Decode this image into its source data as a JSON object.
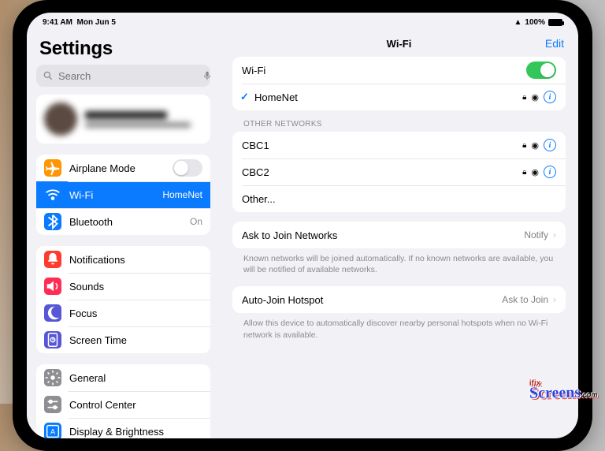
{
  "status": {
    "time": "9:41 AM",
    "date": "Mon Jun 5",
    "battery": "100%"
  },
  "sidebar": {
    "title": "Settings",
    "search_placeholder": "Search",
    "items": {
      "airplane": "Airplane Mode",
      "wifi": "Wi-Fi",
      "wifi_value": "HomeNet",
      "bluetooth": "Bluetooth",
      "bluetooth_value": "On",
      "notifications": "Notifications",
      "sounds": "Sounds",
      "focus": "Focus",
      "screentime": "Screen Time",
      "general": "General",
      "control": "Control Center",
      "display": "Display & Brightness"
    }
  },
  "detail": {
    "title": "Wi-Fi",
    "edit": "Edit",
    "wifi_label": "Wi-Fi",
    "connected": "HomeNet",
    "other_header": "OTHER NETWORKS",
    "networks": {
      "n1": "CBC1",
      "n2": "CBC2",
      "other": "Other..."
    },
    "ask_label": "Ask to Join Networks",
    "ask_value": "Notify",
    "ask_desc": "Known networks will be joined automatically. If no known networks are available, you will be notified of available networks.",
    "auto_label": "Auto-Join Hotspot",
    "auto_value": "Ask to Join",
    "auto_desc": "Allow this device to automatically discover nearby personal hotspots when no Wi-Fi network is available."
  },
  "colors": {
    "orange": "#ff9502",
    "blue": "#0a7aff",
    "red": "#ff3b30",
    "pinkred": "#ff2d55",
    "indigo": "#5856d6",
    "gray": "#8e8e93"
  }
}
